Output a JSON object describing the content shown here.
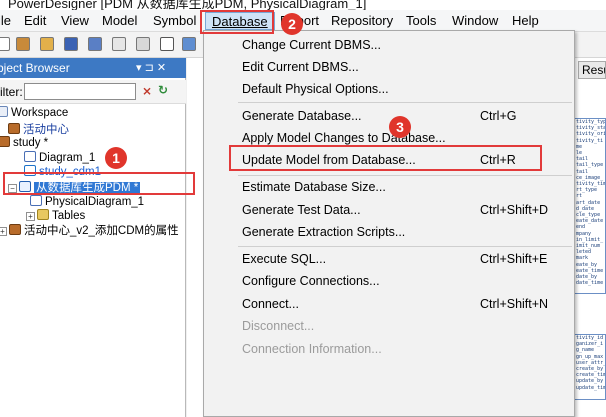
{
  "window": {
    "title": "PowerDesigner [PDM 从数据库生成PDM, PhysicalDiagram_1]"
  },
  "menubar": {
    "items": [
      "ile",
      "Edit",
      "View",
      "Model",
      "Symbol",
      "Database",
      "Report",
      "Repository",
      "Tools",
      "Window",
      "Help"
    ]
  },
  "browser": {
    "title": "bject Browser",
    "pin": "▾ ⊐ ✕",
    "filter_label": "ilter:",
    "filter_value": "",
    "tree": {
      "workspace": "Workspace",
      "pkg1": "活动中心",
      "study": "study *",
      "diagram": "Diagram_1",
      "study_cdm": "study_cdm1",
      "pdm": "从数据库生成PDM *",
      "physical": "PhysicalDiagram_1",
      "tables": "Tables",
      "pkg2": "活动中心_v2_添加CDM的属性"
    }
  },
  "annotations": {
    "one": "1",
    "two": "2",
    "three": "3"
  },
  "canvas": {
    "result_tab": "Resu"
  },
  "entity_top": [
    "tivity_typ",
    "tivity_sta",
    "tivity_ori",
    "tivity_ti",
    "me",
    "le",
    "tail",
    "tail_type",
    "tail",
    "ce_image_",
    "tivity_tim",
    "rt_type",
    "rt",
    "art_date",
    "d_date",
    "cle_type",
    "eate_date",
    "end",
    "mpany",
    "in_limit_",
    "imit_num",
    "leted",
    "mark",
    "eate_by",
    "eate_time",
    "date_by",
    "date_time"
  ],
  "entity_bottom": [
    "tivity_id",
    "ganizer_i",
    "g_name",
    "gn_up_max",
    "user_attr_s",
    "create_by",
    "create_tim",
    "update_by",
    "update_tim"
  ],
  "dropdown": {
    "items": [
      {
        "label": "Change Current DBMS...",
        "shortcut": ""
      },
      {
        "label": "Edit Current DBMS...",
        "shortcut": ""
      },
      {
        "label": "Default Physical Options...",
        "shortcut": ""
      },
      {
        "label": "Generate Database...",
        "shortcut": "Ctrl+G"
      },
      {
        "label": "Apply Model Changes to Database...",
        "shortcut": ""
      },
      {
        "label": "Update Model from Database...",
        "shortcut": "Ctrl+R"
      },
      {
        "label": "Estimate Database Size...",
        "shortcut": ""
      },
      {
        "label": "Generate Test Data...",
        "shortcut": "Ctrl+Shift+D"
      },
      {
        "label": "Generate Extraction Scripts...",
        "shortcut": ""
      },
      {
        "label": "Execute SQL...",
        "shortcut": "Ctrl+Shift+E"
      },
      {
        "label": "Configure Connections...",
        "shortcut": ""
      },
      {
        "label": "Connect...",
        "shortcut": "Ctrl+Shift+N"
      },
      {
        "label": "Disconnect...",
        "shortcut": ""
      },
      {
        "label": "Connection Information...",
        "shortcut": ""
      }
    ]
  },
  "colors": {
    "annotation": "#e0352b",
    "selection": "#3078d4",
    "header": "#3d79c4"
  }
}
